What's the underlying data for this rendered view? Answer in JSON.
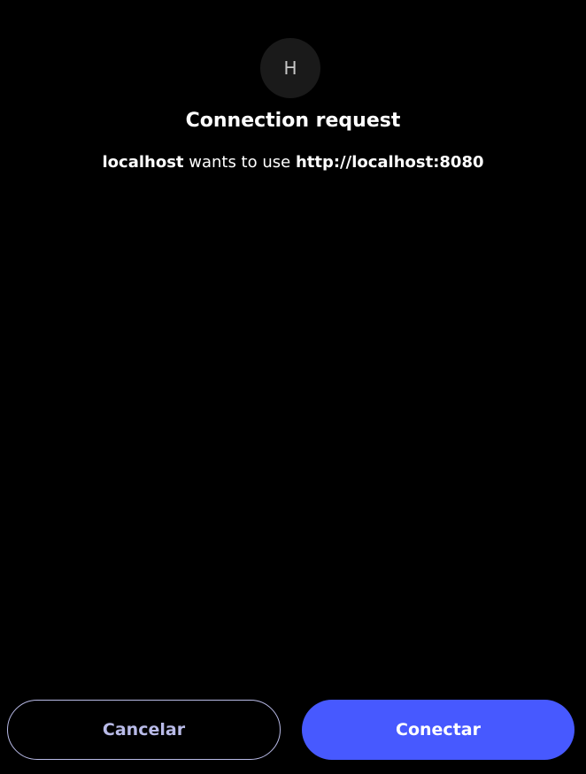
{
  "avatar": {
    "letter": "H"
  },
  "dialog": {
    "title": "Connection request",
    "requester": "localhost",
    "action_text": " wants to use ",
    "target": "http://localhost:8080"
  },
  "buttons": {
    "cancel_label": "Cancelar",
    "connect_label": "Conectar"
  },
  "colors": {
    "background": "#000000",
    "avatar_bg": "#1a1a1a",
    "cancel_border": "#b9bbe8",
    "connect_bg": "#4759ff"
  }
}
